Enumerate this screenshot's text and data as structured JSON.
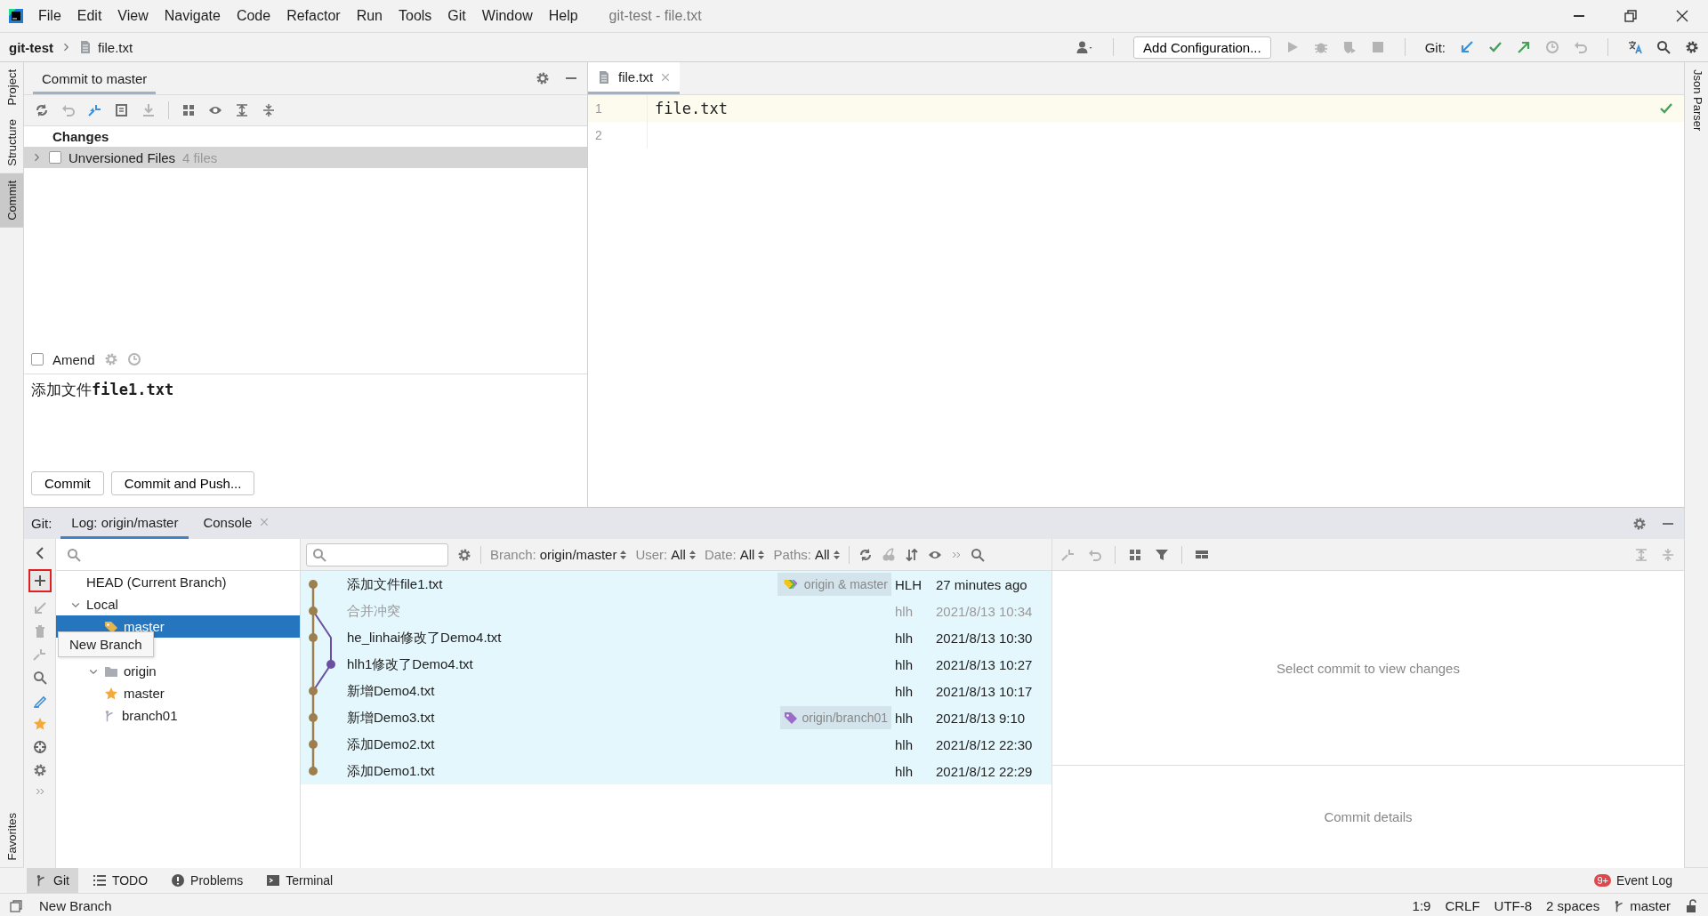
{
  "menu": [
    "File",
    "Edit",
    "View",
    "Navigate",
    "Code",
    "Refactor",
    "Run",
    "Tools",
    "Git",
    "Window",
    "Help"
  ],
  "window_title": "git-test - file.txt",
  "breadcrumb": [
    "git-test",
    "file.txt"
  ],
  "main_toolbar": {
    "config_button": "Add Configuration...",
    "git_label": "Git:"
  },
  "left_stripe": [
    {
      "label": "Project",
      "selected": false
    },
    {
      "label": "Structure",
      "selected": false
    },
    {
      "label": "Commit",
      "selected": true
    }
  ],
  "left_stripe_bottom": [
    "Favorites"
  ],
  "right_stripe": [
    "Json Parser"
  ],
  "commit_panel": {
    "title": "Commit to master",
    "changes_heading": "Changes",
    "groups": [
      {
        "label": "Unversioned Files",
        "count": "4 files",
        "checked": false,
        "expanded": false
      }
    ],
    "amend": {
      "label": "Amend",
      "checked": false
    },
    "message": "添加文件**file1.txt**",
    "buttons": [
      "Commit",
      "Commit and Push..."
    ]
  },
  "editor": {
    "tabs": [
      {
        "label": "file.txt",
        "selected": true
      }
    ],
    "lines": [
      {
        "number": "1",
        "text": "file.txt",
        "current": true
      },
      {
        "number": "2",
        "current": false
      }
    ]
  },
  "git_panel": {
    "label": "Git:",
    "tabs": [
      {
        "label": "Log: origin/master",
        "selected": true,
        "closable": false
      },
      {
        "label": "Console",
        "selected": false,
        "closable": true
      }
    ],
    "new_branch_highlighted": true,
    "branch_tree": [
      {
        "label": "HEAD (Current Branch)",
        "kind": "head"
      },
      {
        "label": "Local",
        "kind": "group",
        "expanded": true,
        "children": [
          {
            "label": "master",
            "kind": "local",
            "selected": true
          }
        ]
      },
      {
        "label": "origin",
        "kind": "folder",
        "expanded": true,
        "children": [
          {
            "label": "master",
            "kind": "favorite",
            "selected": false
          },
          {
            "label": "branch01",
            "kind": "branch",
            "selected": false
          }
        ]
      }
    ],
    "tooltip": "New Branch",
    "filters": [
      {
        "label": "Branch:",
        "value": "origin/master"
      },
      {
        "label": "User:",
        "value": "All"
      },
      {
        "label": "Date:",
        "value": "All"
      },
      {
        "label": "Paths:",
        "value": "All"
      }
    ],
    "commits": [
      {
        "message": "添加文件file1.txt",
        "refs": {
          "label": "origin & master",
          "kind": "multi"
        },
        "author": "HLH",
        "date": "27 minutes ago",
        "dimmed": false,
        "kind": "main"
      },
      {
        "message": "合并冲突",
        "author": "hlh",
        "date": "2021/8/13 10:34",
        "dimmed": true,
        "kind": "main"
      },
      {
        "message": "he_linhai修改了Demo4.txt",
        "author": "hlh",
        "date": "2021/8/13 10:30",
        "dimmed": false,
        "kind": "main"
      },
      {
        "message": "hlh1修改了Demo4.txt",
        "author": "hlh",
        "date": "2021/8/13 10:27",
        "dimmed": false,
        "kind": "side"
      },
      {
        "message": "新增Demo4.txt",
        "author": "hlh",
        "date": "2021/8/13 10:17",
        "dimmed": false,
        "kind": "main"
      },
      {
        "message": "新增Demo3.txt",
        "refs": {
          "label": "origin/branch01",
          "kind": "remote"
        },
        "author": "hlh",
        "date": "2021/8/13 9:10",
        "dimmed": false,
        "kind": "main"
      },
      {
        "message": "添加Demo2.txt",
        "author": "hlh",
        "date": "2021/8/12 22:30",
        "dimmed": false,
        "kind": "main"
      },
      {
        "message": "添加Demo1.txt",
        "author": "hlh",
        "date": "2021/8/12 22:29",
        "dimmed": false,
        "kind": "main"
      }
    ],
    "changes_placeholder": "Select commit to view changes",
    "details_placeholder": "Commit details"
  },
  "tool_windows": [
    {
      "label": "Git",
      "selected": true
    },
    {
      "label": "TODO",
      "selected": false
    },
    {
      "label": "Problems",
      "selected": false
    },
    {
      "label": "Terminal",
      "selected": false
    }
  ],
  "event_log": {
    "label": "Event Log",
    "badge": "9+"
  },
  "status_bar": {
    "message": "New Branch",
    "items": [
      "1:9",
      "CRLF",
      "UTF-8",
      "2 spaces"
    ],
    "branch": "master"
  }
}
